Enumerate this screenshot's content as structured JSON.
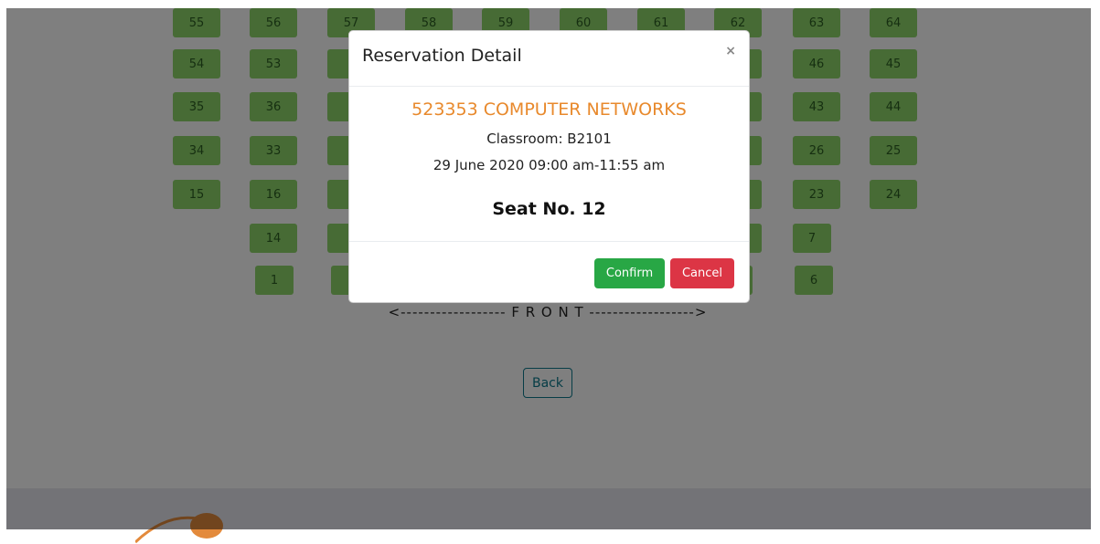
{
  "seats": {
    "row1": [
      "55",
      "56",
      "57",
      "58",
      "59",
      "60",
      "61",
      "62",
      "63",
      "64"
    ],
    "row2": [
      "54",
      "53",
      "46",
      "45"
    ],
    "row3": [
      "35",
      "36",
      "43",
      "44"
    ],
    "row4": [
      "34",
      "33",
      "26",
      "25"
    ],
    "row5": [
      "15",
      "16",
      "23",
      "24"
    ],
    "row6": [
      "14",
      "7"
    ],
    "row7": [
      "1",
      "6"
    ]
  },
  "front_label": "<------------------ F R O N T ------------------>",
  "back_label": "Back",
  "modal": {
    "title": "Reservation Detail",
    "close": "×",
    "course": "523353 COMPUTER NETWORKS",
    "classroom": "Classroom: B2101",
    "datetime": "29 June 2020 09:00 am-11:55 am",
    "seat": "Seat No. 12",
    "confirm_label": "Confirm",
    "cancel_label": "Cancel"
  },
  "colors": {
    "seat_available": "#8ed66a",
    "course_text": "#e8892c",
    "confirm": "#28a745",
    "cancel": "#dc3545",
    "back_border": "#0d7a8d"
  }
}
